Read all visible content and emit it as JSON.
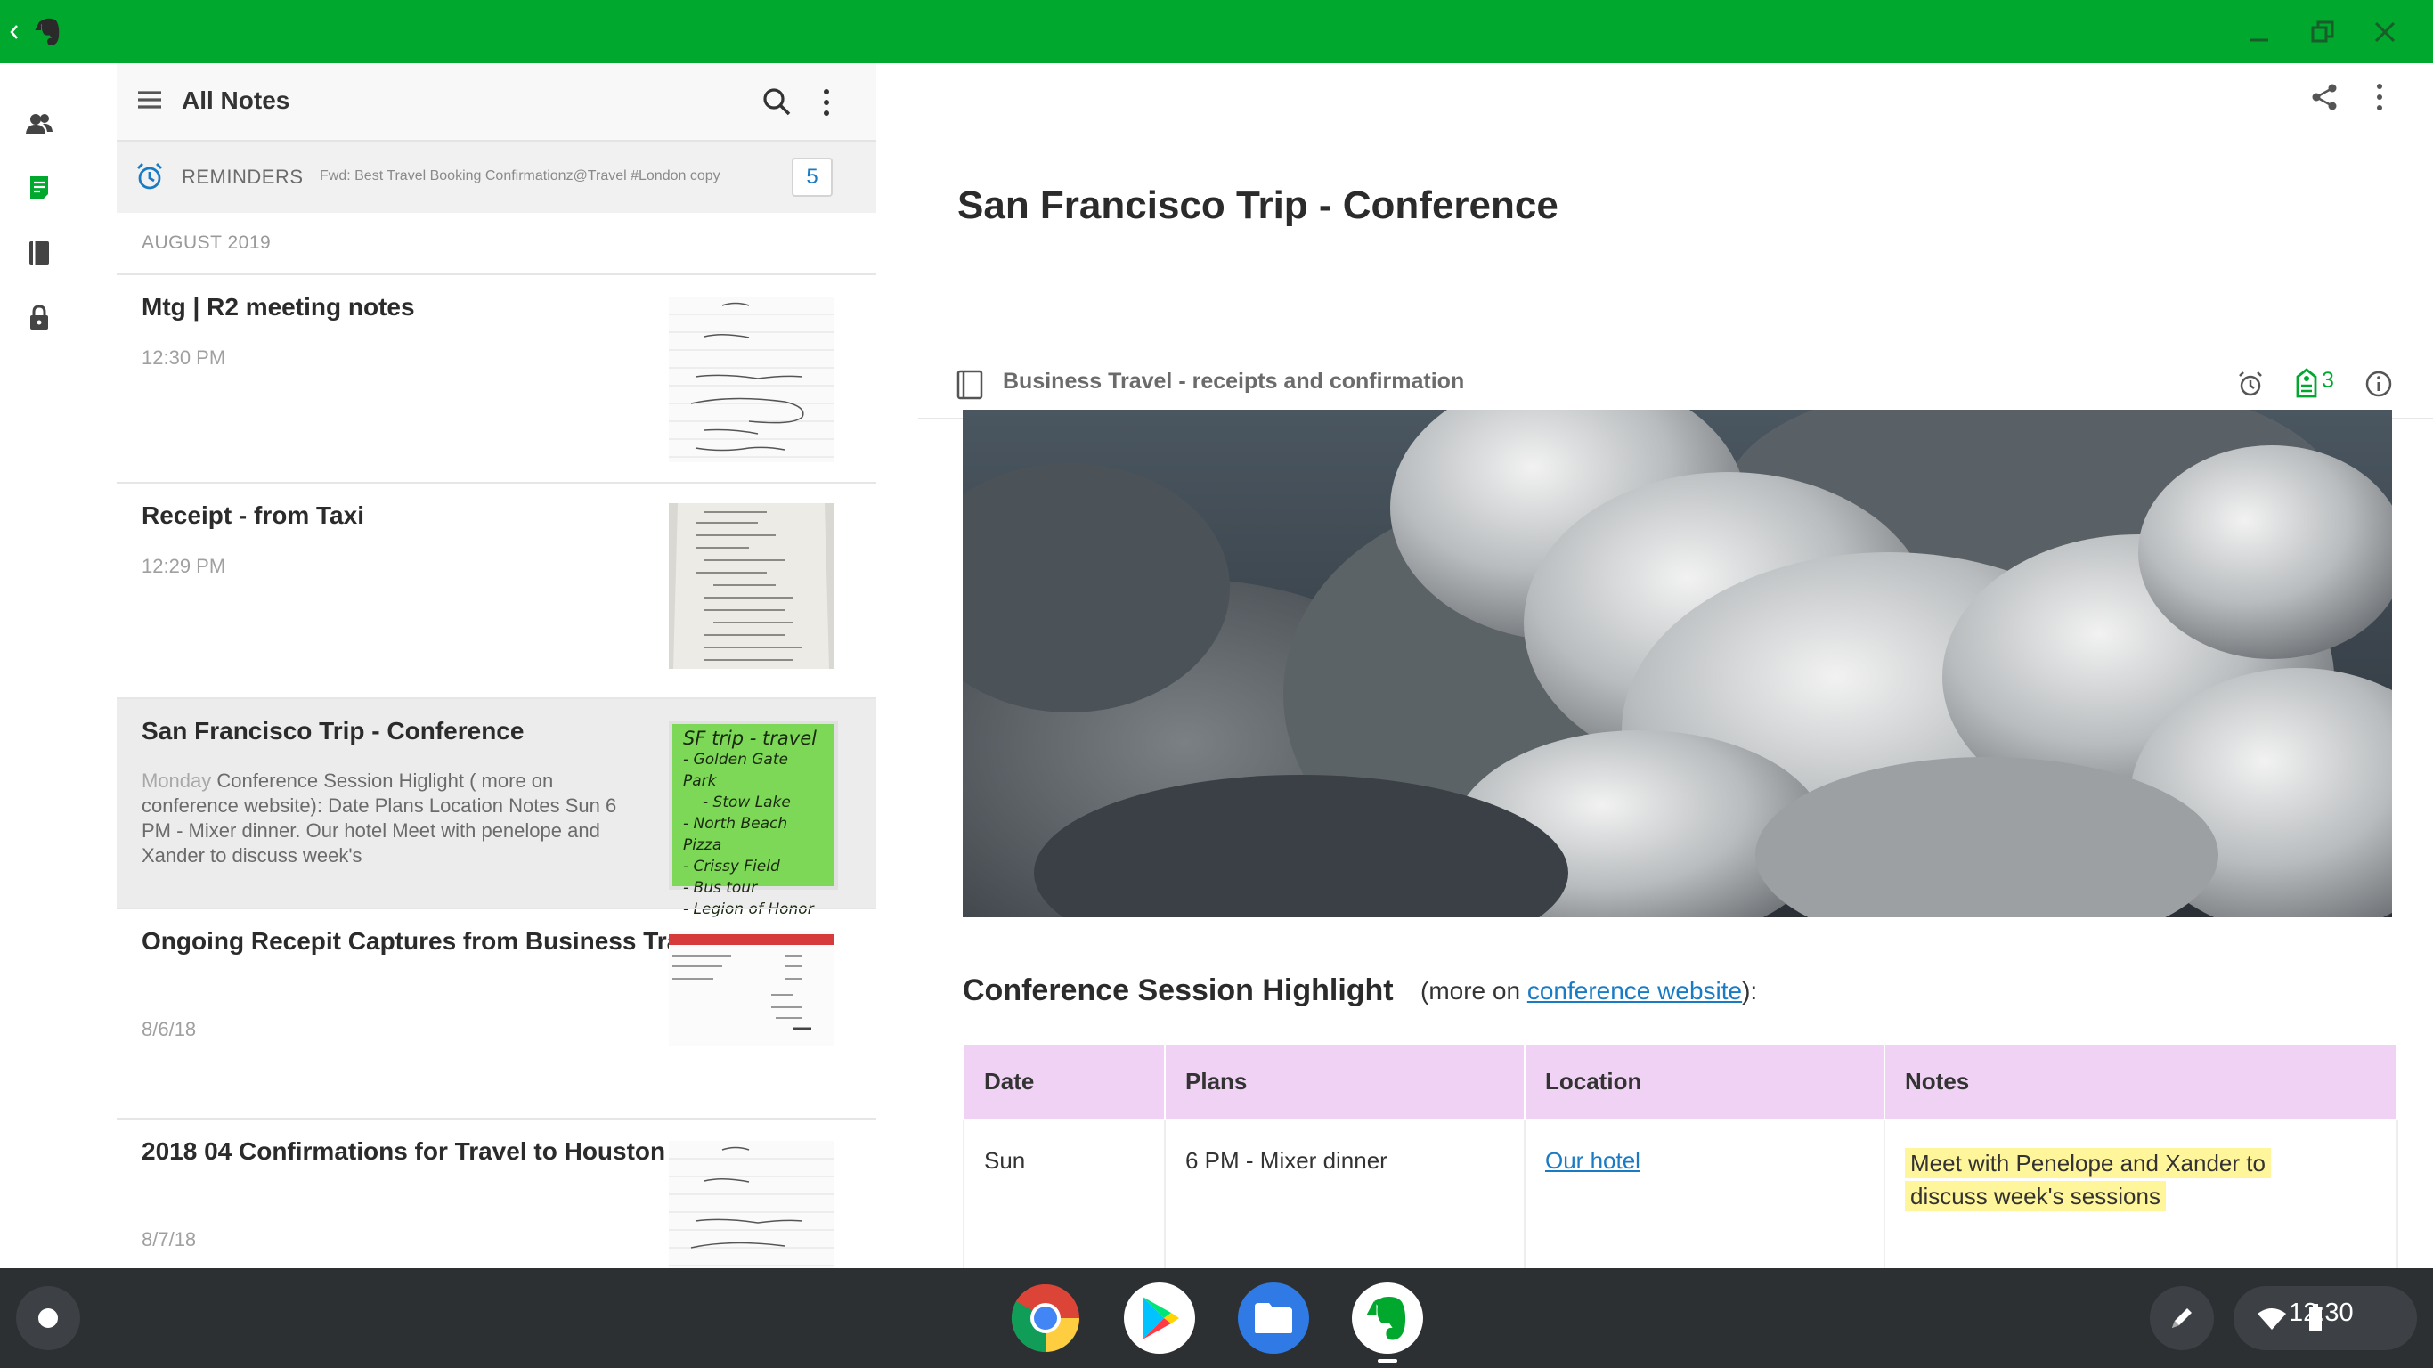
{
  "window": {
    "accent": "#00a82d"
  },
  "list": {
    "title": "All Notes",
    "reminders": {
      "label": "REMINDERS",
      "snippet": "Fwd: Best Travel Booking Confirmationz@Travel #London copy",
      "count": "5"
    },
    "section": "AUGUST 2019",
    "notes": [
      {
        "title": "Mtg | R2 meeting notes",
        "date": "12:30 PM"
      },
      {
        "title": "Receipt - from Taxi",
        "date": "12:29 PM"
      },
      {
        "title": "San Francisco Trip - Conference",
        "day": "Monday",
        "snippet": "Conference Session Higlight ( more on conference website): Date Plans Location Notes Sun 6 PM - Mixer dinner. Our hotel Meet with penelope and Xander to discuss week's"
      },
      {
        "title": "Ongoing Recepit Captures from Business Travel",
        "date": "8/6/18"
      },
      {
        "title": "2018 04 Confirmations for Travel to Houston",
        "date": "8/7/18"
      }
    ],
    "thumb_sticky_lines": [
      "SF trip - travel",
      "- Golden Gate Park",
      "- Stow Lake",
      "- North Beach Pizza",
      "- Crissy Field",
      "- Bus tour",
      "- Legion of Honor"
    ]
  },
  "editor": {
    "title": "San Francisco Trip - Conference",
    "notebook": "Business Travel - receipts and confirmation",
    "tag_count": "3",
    "section_heading": "Conference Session Highlight",
    "section_more_prefix": "(more on ",
    "section_more_link": "conference website",
    "section_more_suffix": "):",
    "table": {
      "headers": [
        "Date",
        "Plans",
        "Location",
        "Notes"
      ],
      "row": {
        "date": "Sun",
        "plans": "6 PM - Mixer dinner",
        "location": "Our hotel",
        "notes_line1": "Meet with Penelope and Xander to",
        "notes_line2": "discuss week's sessions"
      }
    }
  },
  "shelf": {
    "time": "12:30"
  }
}
